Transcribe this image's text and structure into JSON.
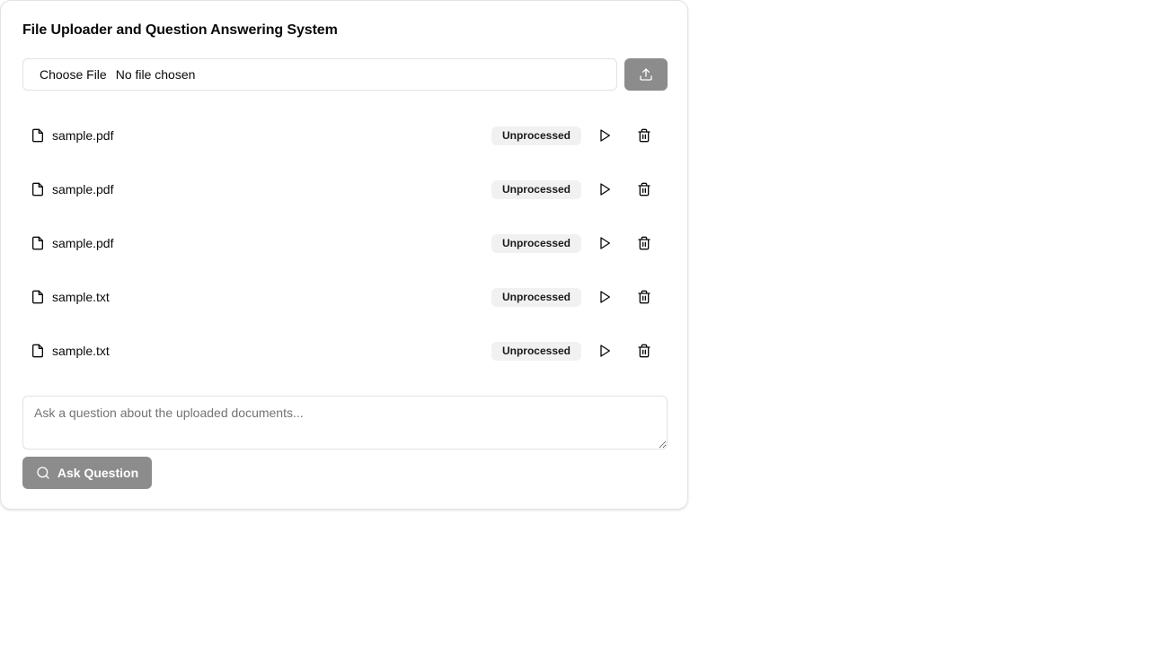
{
  "page": {
    "title": "File Uploader and Question Answering System"
  },
  "uploader": {
    "choose_label": "Choose File",
    "no_file_label": "No file chosen",
    "upload_icon": "upload-icon"
  },
  "files": [
    {
      "name": "sample.pdf",
      "status": "Unprocessed"
    },
    {
      "name": "sample.pdf",
      "status": "Unprocessed"
    },
    {
      "name": "sample.pdf",
      "status": "Unprocessed"
    },
    {
      "name": "sample.txt",
      "status": "Unprocessed"
    },
    {
      "name": "sample.txt",
      "status": "Unprocessed"
    }
  ],
  "question": {
    "placeholder": "Ask a question about the uploaded documents...",
    "value": "",
    "ask_label": "Ask Question"
  },
  "colors": {
    "button_bg": "#8c8c8c",
    "badge_bg": "#f1f1f1",
    "border": "#e2e2e2"
  }
}
